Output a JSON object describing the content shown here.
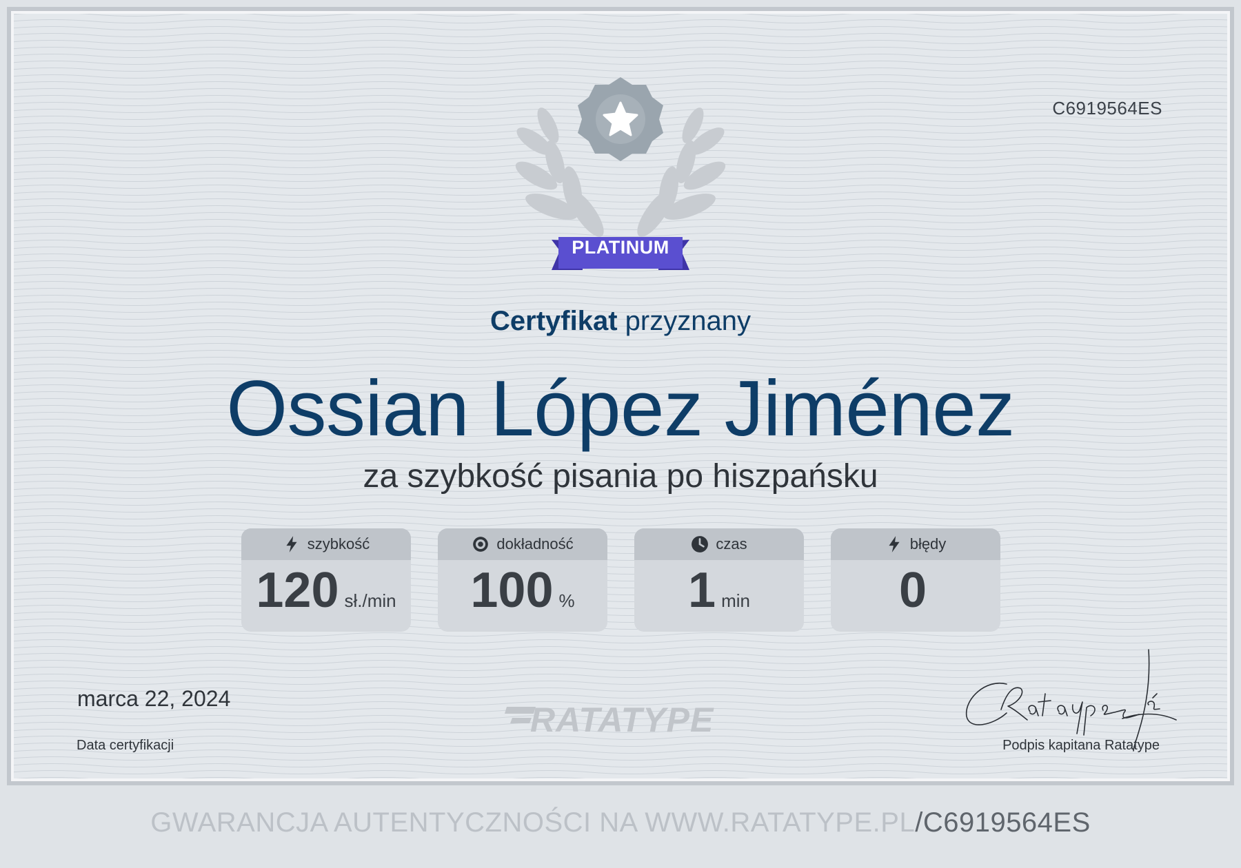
{
  "certificate": {
    "id": "C6919564ES",
    "badge": "PLATINUM",
    "heading_strong": "Certyfikat",
    "heading_rest": "przyznany",
    "recipient_name": "Ossian López Jiménez",
    "subtitle": "za szybkość pisania po hiszpańsku",
    "brand": "RATATYPE"
  },
  "stats": [
    {
      "label": "szybkość",
      "value": "120",
      "unit": "sł./min",
      "icon": "lightning-icon"
    },
    {
      "label": "dokładność",
      "value": "100",
      "unit": "%",
      "icon": "target-icon"
    },
    {
      "label": "czas",
      "value": "1",
      "unit": "min",
      "icon": "clock-icon"
    },
    {
      "label": "błędy",
      "value": "0",
      "unit": "",
      "icon": "lightning-icon"
    }
  ],
  "date": {
    "value": "marca 22, 2024",
    "label": "Data certyfikacji"
  },
  "signature": {
    "label": "Podpis kapitana Ratatype"
  },
  "footer": {
    "prefix": "GWARANCJA AUTENTYCZNOŚCI NA WWW.RATATYPE.PL",
    "suffix": "/C6919564ES"
  },
  "colors": {
    "navy": "#0e3d67",
    "badge": "#5a4fd0",
    "medal": "#9aa5ae"
  }
}
